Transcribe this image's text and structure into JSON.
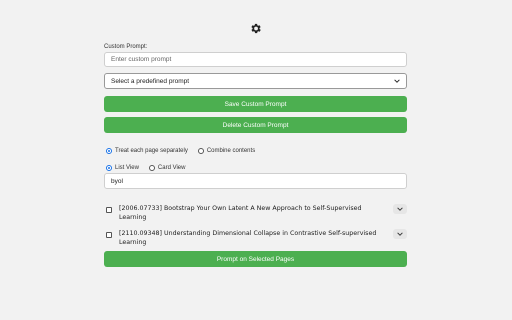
{
  "custom_prompt": {
    "label": "Custom Prompt:",
    "placeholder": "Enter custom prompt"
  },
  "predefined_select": {
    "selected": "Select a predefined prompt"
  },
  "buttons": {
    "save": "Save Custom Prompt",
    "delete": "Delete Custom Prompt",
    "prompt_selected": "Prompt on Selected Pages"
  },
  "mode_options": {
    "separate": "Treat each page separately",
    "combine": "Combine contents"
  },
  "view_options": {
    "list": "List View",
    "card": "Card View"
  },
  "search": {
    "value": "byol"
  },
  "papers": [
    {
      "title": "[2006.07733] Bootstrap Your Own Latent A New Approach to Self-Supervised Learning"
    },
    {
      "title": "[2110.09348] Understanding Dimensional Collapse in Contrastive Self-supervised Learning"
    }
  ],
  "colors": {
    "accent": "#4caf50",
    "radio": "#1a73e8"
  },
  "icons": {
    "settings": "gear-icon",
    "expand": "chevron-down-icon"
  }
}
